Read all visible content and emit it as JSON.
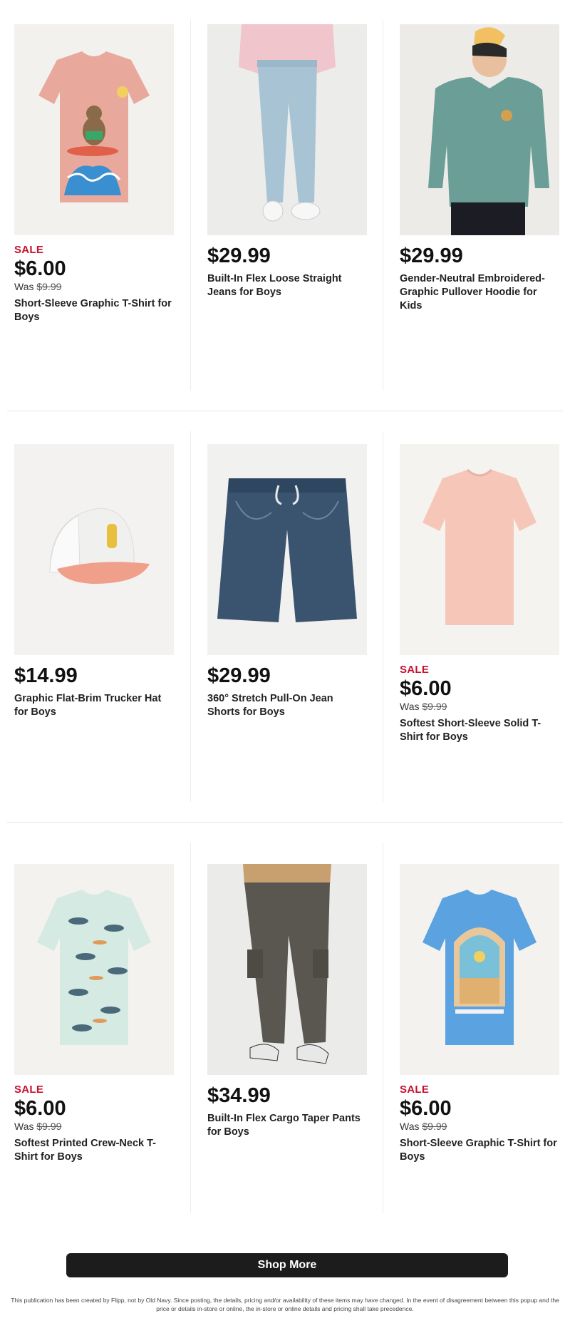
{
  "products": [
    {
      "sale": "SALE",
      "price": "$6.00",
      "was_label": "Was ",
      "was_price": "$9.99",
      "name": "Short-Sleeve Graphic T-Shirt for Boys",
      "image_icon": "tshirt-bear-surf-icon",
      "color": "#e8a99c"
    },
    {
      "sale": "",
      "price": "$29.99",
      "was_label": "",
      "was_price": "",
      "name": "Built-In Flex Loose Straight Jeans for Boys",
      "image_icon": "jeans-icon",
      "color": "#a8c4d4"
    },
    {
      "sale": "",
      "price": "$29.99",
      "was_label": "",
      "was_price": "",
      "name": "Gender-Neutral Embroidered-Graphic Pullover Hoodie for Kids",
      "image_icon": "hoodie-icon",
      "color": "#6a9e96"
    },
    {
      "sale": "",
      "price": "$14.99",
      "was_label": "",
      "was_price": "",
      "name": "Graphic Flat-Brim Trucker Hat for Boys",
      "image_icon": "trucker-hat-icon",
      "color": "#f0a08a"
    },
    {
      "sale": "",
      "price": "$29.99",
      "was_label": "",
      "was_price": "",
      "name": "360° Stretch Pull-On Jean Shorts for Boys",
      "image_icon": "jean-shorts-icon",
      "color": "#3a5470"
    },
    {
      "sale": "SALE",
      "price": "$6.00",
      "was_label": "Was ",
      "was_price": "$9.99",
      "name": "Softest Short-Sleeve Solid T-Shirt for Boys",
      "image_icon": "tshirt-solid-icon",
      "color": "#f6c7b8"
    },
    {
      "sale": "SALE",
      "price": "$6.00",
      "was_label": "Was ",
      "was_price": "$9.99",
      "name": "Softest Printed Crew-Neck T-Shirt for Boys",
      "image_icon": "tshirt-printed-icon",
      "color": "#d6eae4"
    },
    {
      "sale": "",
      "price": "$34.99",
      "was_label": "",
      "was_price": "",
      "name": "Built-In Flex Cargo Taper Pants for Boys",
      "image_icon": "cargo-pants-icon",
      "color": "#5a5650"
    },
    {
      "sale": "SALE",
      "price": "$6.00",
      "was_label": "Was ",
      "was_price": "$9.99",
      "name": "Short-Sleeve Graphic T-Shirt for Boys",
      "image_icon": "tshirt-blue-graphic-icon",
      "color": "#5aa2e0"
    }
  ],
  "shop_more_label": "Shop More",
  "disclaimer": "This publication has been created by Flipp, not by Old Navy. Since posting, the details, pricing and/or availability of these items may have changed. In the event of disagreement between this popup and the price or details in-store or online, the in-store or online details and pricing shall take precedence.",
  "colors": {
    "sale": "#c8102e",
    "button_bg": "#1c1c1c"
  }
}
